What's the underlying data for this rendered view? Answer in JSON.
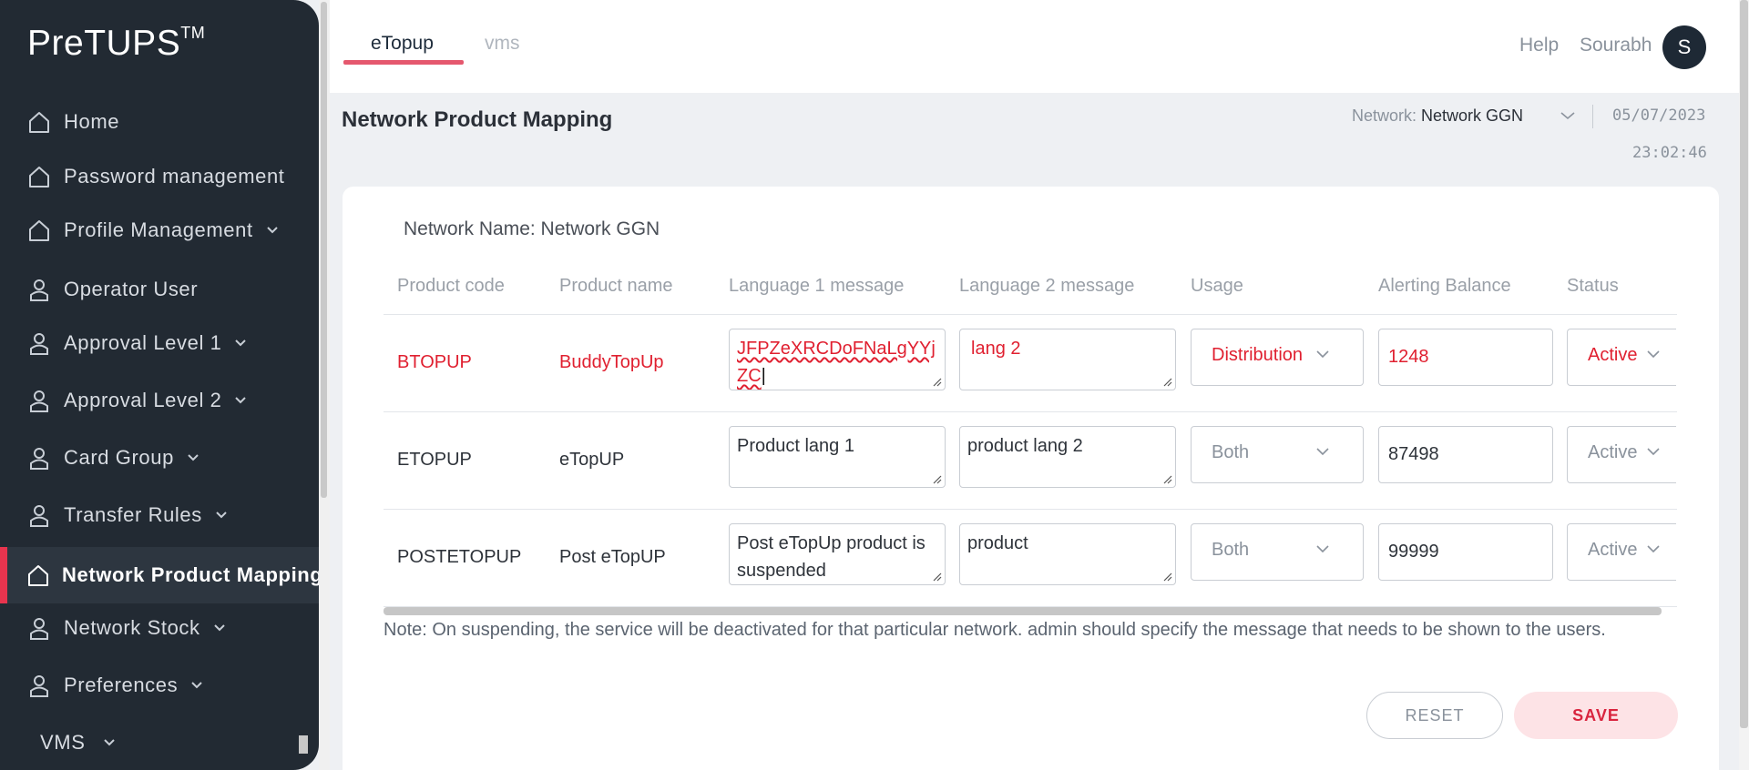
{
  "app": {
    "logo": "PreTUPS",
    "logo_tm": "TM"
  },
  "sidebar": {
    "items": [
      {
        "label": "Home",
        "icon": "home-icon",
        "chevron": false
      },
      {
        "label": "Password management",
        "icon": "home-icon",
        "chevron": false
      },
      {
        "label": "Profile Management",
        "icon": "home-icon",
        "chevron": true
      },
      {
        "label": "Operator User",
        "icon": "user-icon",
        "chevron": false
      },
      {
        "label": "Approval Level 1",
        "icon": "user-icon",
        "chevron": true
      },
      {
        "label": "Approval Level 2",
        "icon": "user-icon",
        "chevron": true
      },
      {
        "label": "Card Group",
        "icon": "user-icon",
        "chevron": true
      },
      {
        "label": "Transfer Rules",
        "icon": "user-icon",
        "chevron": true
      },
      {
        "label": "Network Product Mapping",
        "icon": "home-icon",
        "chevron": false,
        "active": true
      },
      {
        "label": "Network Stock",
        "icon": "user-icon",
        "chevron": true
      },
      {
        "label": "Preferences",
        "icon": "user-icon",
        "chevron": true
      },
      {
        "label": "VMS",
        "icon": "",
        "chevron": true
      }
    ]
  },
  "topbar": {
    "tabs": [
      {
        "label": "eTopup",
        "active": true
      },
      {
        "label": "vms",
        "active": false
      }
    ],
    "help": "Help",
    "user": "Sourabh",
    "avatar": "S"
  },
  "header": {
    "title": "Network Product Mapping",
    "network_label": "Network:",
    "network_value": "Network GGN",
    "date": "05/07/2023",
    "time": "23:02:46"
  },
  "main": {
    "network_name": "Network Name: Network GGN",
    "columns": [
      "Product code",
      "Product name",
      "Language 1 message",
      "Language 2 message",
      "Usage",
      "Alerting Balance",
      "Status"
    ],
    "rows": [
      {
        "code": "BTOPUP",
        "name": "BuddyTopUp",
        "lang1": "JFPZeXRCDoFNaLgYYjZC",
        "lang2": " lang 2",
        "usage": "Distribution",
        "balance": "1248",
        "status": "Active",
        "error": true
      },
      {
        "code": "ETOPUP",
        "name": "eTopUP",
        "lang1": "Product lang 1",
        "lang2": "product lang 2",
        "usage": "Both",
        "balance": "87498",
        "status": "Active",
        "error": false
      },
      {
        "code": "POSTETOPUP",
        "name": "Post eTopUP",
        "lang1": "Post eTopUp product is suspended",
        "lang2": "product",
        "usage": "Both",
        "balance": "99999",
        "status": "Active",
        "error": false
      }
    ],
    "note": "Note: On suspending, the service will be deactivated for that particular network. admin should specify the message that needs to be shown to the users.",
    "reset_label": "RESET",
    "save_label": "SAVE"
  },
  "colors": {
    "sidebar_bg": "#222a33",
    "accent": "#e8344e",
    "error": "#e02030",
    "save_bg": "#fde3e6"
  }
}
